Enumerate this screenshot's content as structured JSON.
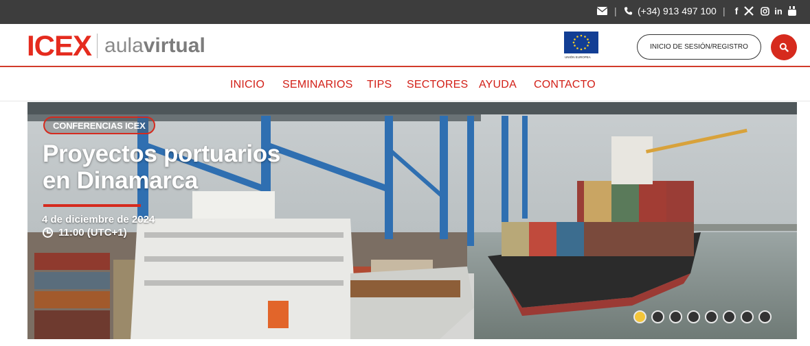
{
  "topbar": {
    "separator": "|",
    "phone": "(+34) 913 497 100",
    "icons": [
      "mail-icon",
      "phone-icon",
      "facebook-icon",
      "x-icon",
      "instagram-icon",
      "linkedin-icon",
      "youtube-icon"
    ]
  },
  "header": {
    "logo_brand": "ICEX",
    "logo_aula": "aula",
    "logo_virtual": "virtual",
    "eu_label": "UNIÓN EUROPEA",
    "login_label": "INICIO DE SESIÓN/REGISTRO"
  },
  "nav": {
    "items": [
      "INICIO",
      "SEMINARIOS",
      "TIPS",
      "SECTORES",
      "AYUDA",
      "CONTACTO"
    ]
  },
  "hero": {
    "badge": "CONFERENCIAS ICEX",
    "title_line1": "Proyectos portuarios",
    "title_line2": "en Dinamarca",
    "date": "4 de diciembre de 2024",
    "time": "11:00 (UTC+1)",
    "slide_count": 8,
    "active_slide": 1
  },
  "colors": {
    "brand_red": "#d21e16",
    "topbar_bg": "#3d3d3d",
    "dot_active": "#f3c53a"
  }
}
